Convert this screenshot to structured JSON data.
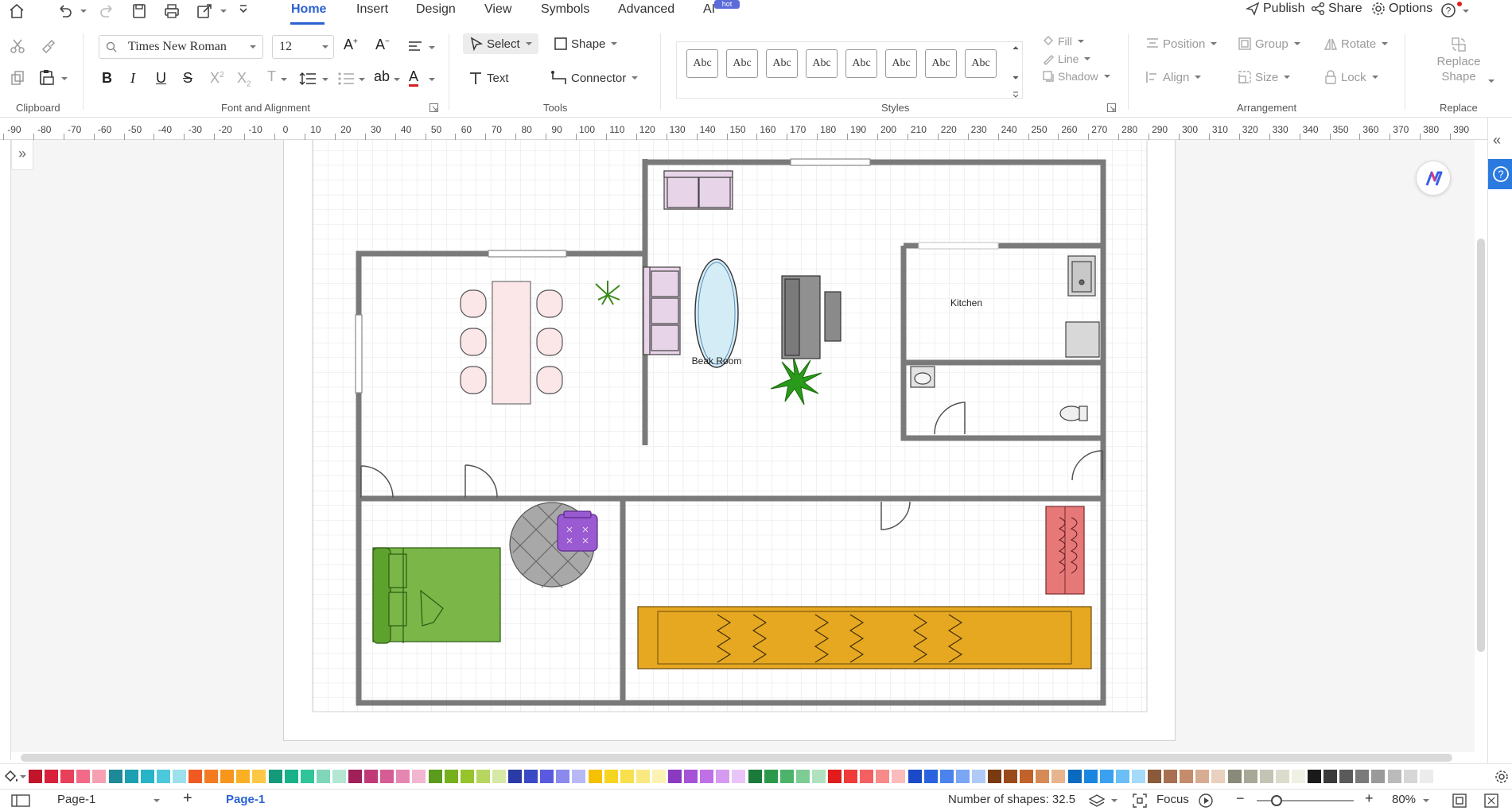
{
  "topbar": {
    "tabs": [
      "Home",
      "Insert",
      "Design",
      "View",
      "Symbols",
      "Advanced",
      "AI"
    ],
    "hot_badge": "hot",
    "publish": "Publish",
    "share": "Share",
    "options": "Options"
  },
  "ribbon": {
    "font_name": "Times New Roman",
    "font_size": "12",
    "select_label": "Select",
    "shape_label": "Shape",
    "text_label": "Text",
    "connector_label": "Connector",
    "style_samples": [
      "Abc",
      "Abc",
      "Abc",
      "Abc",
      "Abc",
      "Abc",
      "Abc",
      "Abc"
    ],
    "fill": "Fill",
    "line": "Line",
    "shadow": "Shadow",
    "position": "Position",
    "group": "Group",
    "rotate": "Rotate",
    "align": "Align",
    "size": "Size",
    "lock": "Lock",
    "replace_shape_1": "Replace",
    "replace_shape_2": "Shape",
    "groups": {
      "clipboard": "Clipboard",
      "font": "Font and Alignment",
      "tools": "Tools",
      "styles": "Styles",
      "arrangement": "Arrangement",
      "replace": "Replace"
    }
  },
  "ruler_ticks": [
    "-90",
    "-80",
    "-70",
    "-60",
    "-50",
    "-40",
    "-30",
    "-20",
    "-10",
    "0",
    "10",
    "20",
    "30",
    "40",
    "50",
    "60",
    "70",
    "80",
    "90",
    "100",
    "110",
    "120",
    "130",
    "140",
    "150",
    "160",
    "170",
    "180",
    "190",
    "200",
    "210",
    "220",
    "230",
    "240",
    "250",
    "260",
    "270",
    "280",
    "290",
    "300",
    "310",
    "320",
    "330",
    "340",
    "350",
    "360",
    "370",
    "380",
    "390"
  ],
  "floorplan": {
    "break_room": "Beak Room",
    "kitchen": "Kitchen"
  },
  "palette": [
    "#c0152a",
    "#d8203a",
    "#e8405a",
    "#f26a88",
    "#f6a0b4",
    "#1c8a98",
    "#1aa0b0",
    "#26b4c8",
    "#4cc8dc",
    "#9ce0ec",
    "#f05a22",
    "#f47a22",
    "#f8961c",
    "#fab022",
    "#fcc844",
    "#149a7a",
    "#18b28a",
    "#30c49a",
    "#80d6b8",
    "#b4e6d4",
    "#a0205a",
    "#c03a78",
    "#d65c96",
    "#e686b2",
    "#f2b6d0",
    "#5a9a1c",
    "#76b01c",
    "#96c42a",
    "#b6d660",
    "#d6e8a6",
    "#2a3aa6",
    "#3a4ac6",
    "#5a5ae0",
    "#8a8aee",
    "#b8b8f6",
    "#f4c000",
    "#f6d420",
    "#f8e04c",
    "#fae880",
    "#fcf2b4",
    "#8a3ac0",
    "#a652d6",
    "#c070e6",
    "#d69af0",
    "#e8c4f8",
    "#1a7a3a",
    "#2a9a4a",
    "#4cb46a",
    "#7ccc94",
    "#b0e2c0",
    "#e01c1c",
    "#f03a3a",
    "#f46060",
    "#f88a8a",
    "#fbbcbc",
    "#1a4ac8",
    "#2a62e0",
    "#4a82ee",
    "#7aa6f4",
    "#b0caf8",
    "#7a3a10",
    "#9a4a1a",
    "#c0622a",
    "#d68a56",
    "#e8b48e",
    "#0a6ac0",
    "#1a86e0",
    "#3aa0f0",
    "#6ac0f6",
    "#a6dafa",
    "#8a5a3a",
    "#a87050",
    "#c48c6a",
    "#d8ac92",
    "#ead0be",
    "#8a8a7a",
    "#a8a898",
    "#c4c4b4",
    "#dcdccc",
    "#f0f0e4",
    "#1a1a1a",
    "#3a3a3a",
    "#5a5a5a",
    "#7a7a7a",
    "#9a9a9a",
    "#bababa",
    "#d6d6d6",
    "#ececec"
  ],
  "status": {
    "page_tab": "Page-1",
    "active_page": "Page-1",
    "shapes_count": "Number of shapes: 32.5",
    "focus": "Focus",
    "zoom": "80%"
  }
}
